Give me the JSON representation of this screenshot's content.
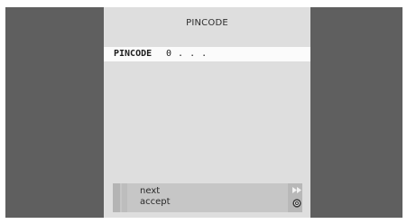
{
  "dialog": {
    "title": "PINCODE"
  },
  "pin_entry": {
    "label": "PINCODE",
    "value": "0 . . ."
  },
  "footer": {
    "next_label": "next",
    "accept_label": "accept",
    "next_icon": "fast-forward-icon",
    "accept_icon": "ok-button-icon"
  },
  "colors": {
    "background": "#5f5f5f",
    "dialog": "#dedede",
    "highlight_row": "#fbfbfb",
    "footer": "#c6c6c6"
  }
}
